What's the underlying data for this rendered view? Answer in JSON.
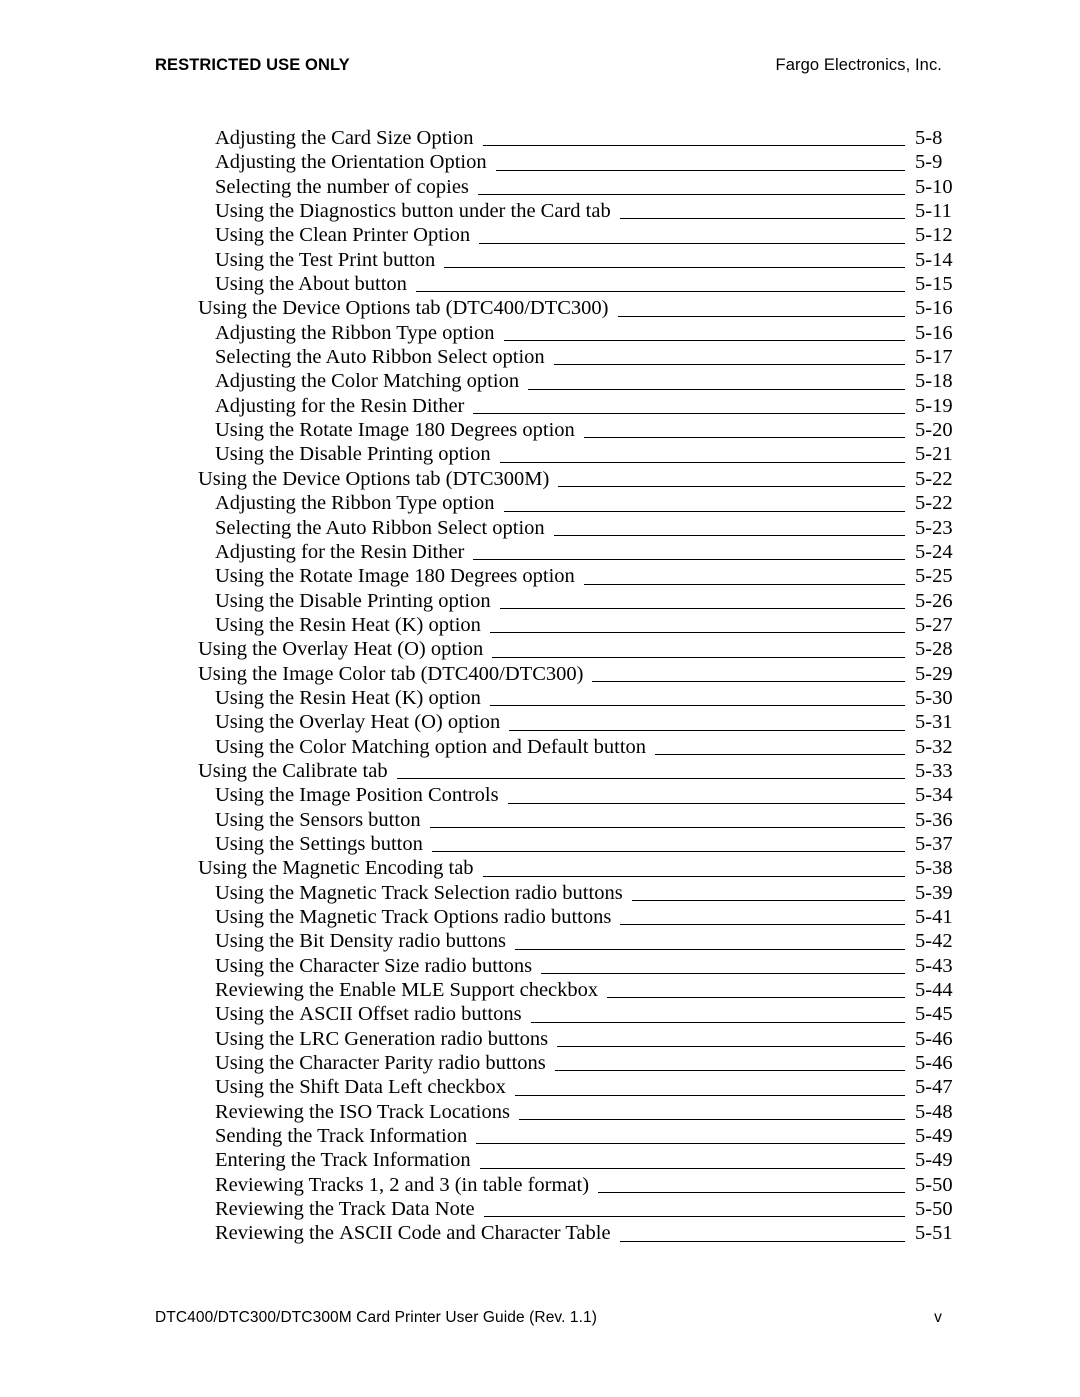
{
  "header": {
    "left": "RESTRICTED USE ONLY",
    "right": "Fargo Electronics, Inc."
  },
  "footer": {
    "left": "DTC400/DTC300/DTC300M Card Printer User Guide (Rev. 1.1)",
    "right": "v"
  },
  "toc": {
    "entries": [
      {
        "title": "Adjusting the Card Size Option",
        "page": "5-8",
        "level": 1
      },
      {
        "title": "Adjusting the Orientation Option",
        "page": "5-9",
        "level": 1
      },
      {
        "title": "Selecting the number of copies",
        "page": "5-10",
        "level": 1
      },
      {
        "title": "Using the Diagnostics button under the Card tab",
        "page": "5-11",
        "level": 1
      },
      {
        "title": "Using the Clean Printer Option",
        "page": "5-12",
        "level": 1
      },
      {
        "title": "Using the Test Print button",
        "page": "5-14",
        "level": 1
      },
      {
        "title": "Using the About button",
        "page": "5-15",
        "level": 1
      },
      {
        "title": "Using the Device Options tab (DTC400/DTC300)",
        "page": "5-16",
        "level": 0
      },
      {
        "title": "Adjusting the Ribbon Type option",
        "page": "5-16",
        "level": 1
      },
      {
        "title": "Selecting the Auto Ribbon Select option",
        "page": "5-17",
        "level": 1
      },
      {
        "title": "Adjusting the Color Matching option",
        "page": "5-18",
        "level": 1
      },
      {
        "title": "Adjusting for the Resin Dither",
        "page": "5-19",
        "level": 1
      },
      {
        "title": "Using the Rotate Image 180 Degrees option",
        "page": "5-20",
        "level": 1
      },
      {
        "title": "Using the Disable Printing option",
        "page": "5-21",
        "level": 1
      },
      {
        "title": "Using the Device Options tab (DTC300M)",
        "page": "5-22",
        "level": 0
      },
      {
        "title": "Adjusting the Ribbon Type option",
        "page": "5-22",
        "level": 1
      },
      {
        "title": "Selecting the Auto Ribbon Select option",
        "page": "5-23",
        "level": 1
      },
      {
        "title": "Adjusting for the Resin Dither",
        "page": "5-24",
        "level": 1
      },
      {
        "title": "Using the Rotate Image 180 Degrees option",
        "page": "5-25",
        "level": 1
      },
      {
        "title": "Using the Disable Printing option",
        "page": "5-26",
        "level": 1
      },
      {
        "title": "Using the Resin Heat (K) option",
        "page": "5-27",
        "level": 1
      },
      {
        "title": "Using the Overlay Heat (O) option",
        "page": "5-28",
        "level": 0
      },
      {
        "title": "Using the Image Color tab (DTC400/DTC300)",
        "page": "5-29",
        "level": 0
      },
      {
        "title": "Using the Resin Heat (K) option",
        "page": "5-30",
        "level": 1
      },
      {
        "title": "Using the Overlay Heat (O) option",
        "page": "5-31",
        "level": 1
      },
      {
        "title": "Using the Color Matching option and Default button",
        "page": "5-32",
        "level": 1
      },
      {
        "title": "Using the Calibrate tab",
        "page": "5-33",
        "level": 0
      },
      {
        "title": "Using the Image Position Controls",
        "page": "5-34",
        "level": 1
      },
      {
        "title": "Using the Sensors button",
        "page": "5-36",
        "level": 1
      },
      {
        "title": "Using the Settings button",
        "page": "5-37",
        "level": 1
      },
      {
        "title": "Using the Magnetic Encoding tab",
        "page": "5-38",
        "level": 0
      },
      {
        "title": "Using the Magnetic Track Selection radio buttons",
        "page": "5-39",
        "level": 1
      },
      {
        "title": "Using the Magnetic Track Options radio buttons",
        "page": "5-41",
        "level": 1
      },
      {
        "title": "Using the Bit Density radio buttons",
        "page": "5-42",
        "level": 1
      },
      {
        "title": "Using the Character Size radio buttons",
        "page": "5-43",
        "level": 1
      },
      {
        "title": "Reviewing the Enable MLE Support checkbox",
        "page": "5-44",
        "level": 1
      },
      {
        "title": "Using the ASCII Offset radio buttons",
        "page": "5-45",
        "level": 1,
        "smallcaps": "ASCII"
      },
      {
        "title": "Using the LRC Generation radio buttons",
        "page": "5-46",
        "level": 1
      },
      {
        "title": "Using the Character Parity radio buttons",
        "page": "5-46",
        "level": 1
      },
      {
        "title": "Using the Shift Data Left checkbox",
        "page": "5-47",
        "level": 1
      },
      {
        "title": "Reviewing the ISO Track Locations",
        "page": "5-48",
        "level": 1
      },
      {
        "title": "Sending the Track Information",
        "page": "5-49",
        "level": 1
      },
      {
        "title": "Entering the Track Information",
        "page": "5-49",
        "level": 1
      },
      {
        "title": "Reviewing Tracks 1, 2 and 3 (in table format)",
        "page": "5-50",
        "level": 1
      },
      {
        "title": "Reviewing the Track Data Note",
        "page": "5-50",
        "level": 1
      },
      {
        "title": "Reviewing the ASCII Code and Character Table",
        "page": "5-51",
        "level": 1,
        "smallcaps": "ASCII"
      }
    ]
  }
}
